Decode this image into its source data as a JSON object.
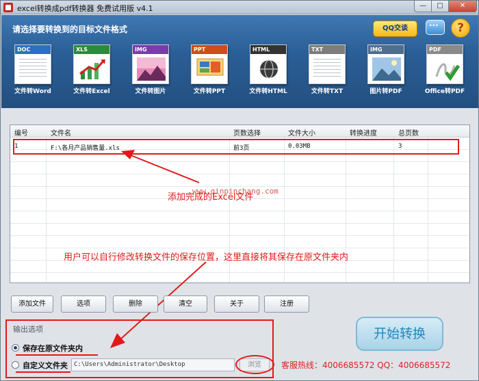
{
  "window": {
    "title": "excel转换成pdf转换器 免费试用版 v4.1",
    "min": "—",
    "max": "□",
    "close": "✕"
  },
  "banner": {
    "instruction": "请选择要转换到的目标文件格式",
    "qq_button": "QQ交谈",
    "help": "?"
  },
  "tools": [
    {
      "badge": "DOC",
      "label": "文件转Word",
      "color": "#2f6fc0"
    },
    {
      "badge": "XLS",
      "label": "文件转Excel",
      "color": "#2d8a3b"
    },
    {
      "badge": "IMG",
      "label": "文件转图片",
      "color": "#7a3da8"
    },
    {
      "badge": "PPT",
      "label": "文件转PPT",
      "color": "#d24b1e"
    },
    {
      "badge": "HTML",
      "label": "文件转HTML",
      "color": "#333333"
    },
    {
      "badge": "TXT",
      "label": "文件转TXT",
      "color": "#7d7d7d"
    },
    {
      "badge": "IMG",
      "label": "图片转PDF",
      "color": "#4f6f8f"
    },
    {
      "badge": "PDF",
      "label": "Office转PDF",
      "color": "#8a8a8a"
    }
  ],
  "table": {
    "columns": [
      "编号",
      "文件名",
      "页数选择",
      "文件大小",
      "转换进度",
      "总页数"
    ],
    "rows": [
      {
        "num": "1",
        "name": "F:\\各月产品销售量.xls",
        "pages": "前3页",
        "size": "0.03MB",
        "progress": "",
        "total": "3"
      }
    ]
  },
  "annotations": {
    "url": "www.qinpinchang.com",
    "added": "添加完成的Excel文件",
    "save_note": "用户可以自行修改转换文件的保存位置，这里直接将其保存在原文件夹内"
  },
  "buttons": {
    "add": "添加文件",
    "options": "选项",
    "delete": "删除",
    "clear": "清空",
    "about": "关于",
    "register": "注册"
  },
  "output": {
    "legend": "输出选项",
    "opt_original": "保存在原文件夹内",
    "opt_custom": "自定义文件夹",
    "path": "C:\\Users\\Administrator\\Desktop",
    "browse": "浏览"
  },
  "start": "开始转换",
  "hotline": "客服热线：4006685572 QQ：4006685572"
}
